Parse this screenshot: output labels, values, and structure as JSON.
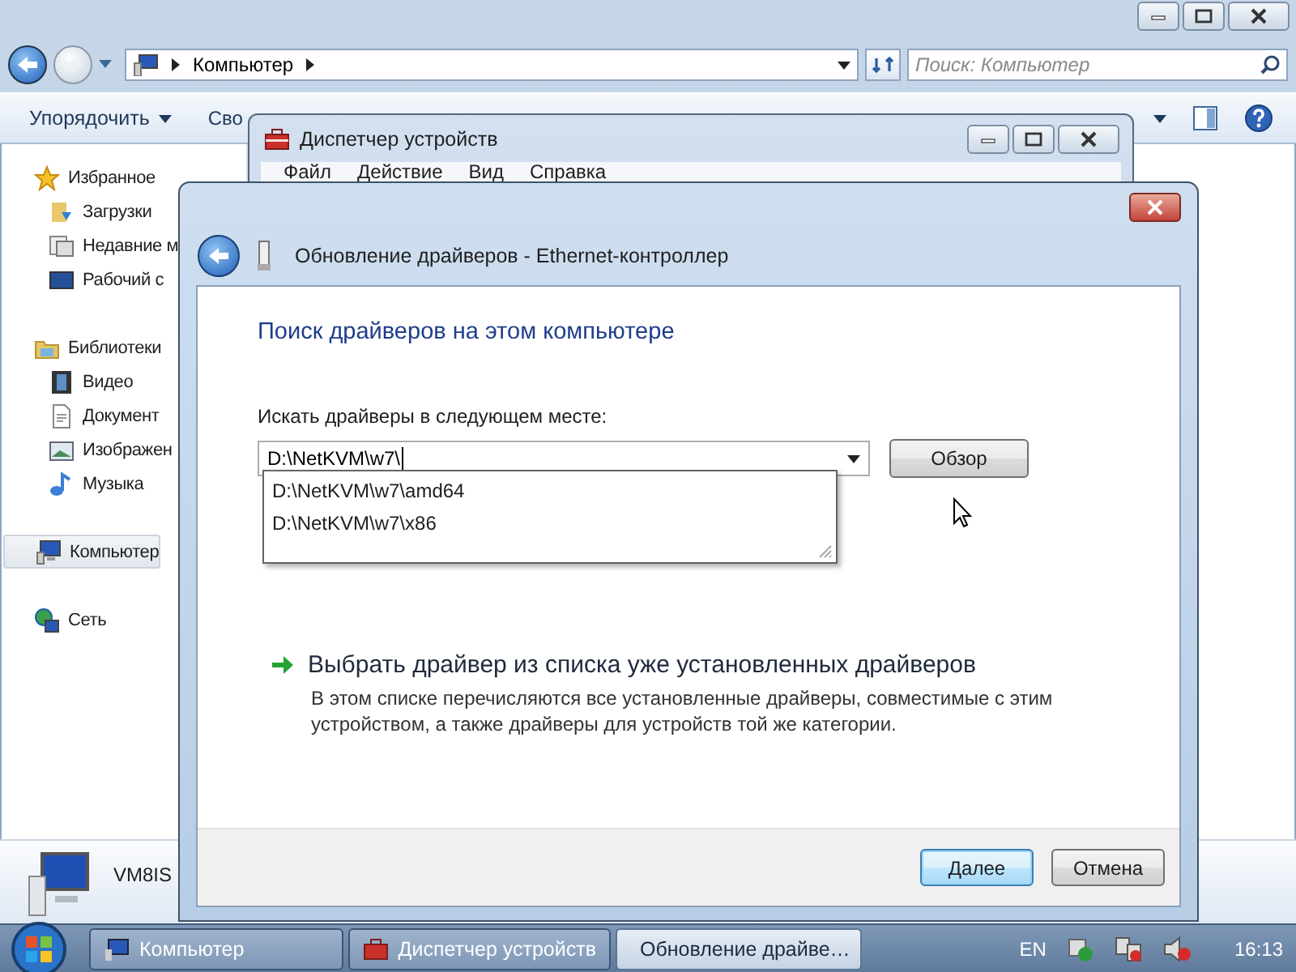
{
  "explorer": {
    "address_path": "Компьютер",
    "search": {
      "placeholder": "Поиск: Компьютер"
    },
    "toolbar": [
      "Упорядочить",
      "Сво"
    ],
    "sidebar": {
      "items": [
        {
          "label": "Избранное",
          "selected": false,
          "children": [
            {
              "label": "Загрузки",
              "selected": false
            },
            {
              "label": "Недавние м",
              "selected": false
            },
            {
              "label": "Рабочий с",
              "selected": false
            }
          ]
        },
        {
          "label": "Библиотеки",
          "selected": false,
          "children": [
            {
              "label": "Видео",
              "selected": false
            },
            {
              "label": "Документ",
              "selected": false
            },
            {
              "label": "Изображен",
              "selected": false
            },
            {
              "label": "Музыка",
              "selected": false
            }
          ]
        },
        {
          "label": "Компьютер",
          "selected": true
        },
        {
          "label": "Сеть",
          "selected": false
        }
      ]
    },
    "details": {
      "name": "VM8IS"
    }
  },
  "device_manager": {
    "title": "Диспетчер устройств",
    "menu": [
      "Файл",
      "Действие",
      "Вид",
      "Справка"
    ]
  },
  "dialog": {
    "title": "Обновление драйверов - Ethernet-контроллер",
    "heading": "Поиск драйверов на этом компьютере",
    "location_label": "Искать драйверы в следующем месте:",
    "location": {
      "value": "D:\\NetKVM\\w7\\",
      "suggestions": [
        "D:\\NetKVM\\w7\\amd64",
        "D:\\NetKVM\\w7\\x86"
      ]
    },
    "browse_button": "Обзор",
    "link": {
      "label": "Выбрать драйвер из списка уже установленных драйверов",
      "description": "В этом списке перечисляются все установленные драйверы, совместимые с этим устройством, а также драйверы для устройств той же категории."
    },
    "buttons": [
      {
        "label": "Далее",
        "default": true
      },
      {
        "label": "Отмена",
        "default": false
      }
    ]
  },
  "taskbar": {
    "tasks": [
      {
        "label": "Компьютер",
        "selected": false
      },
      {
        "label": "Диспетчер устройств",
        "selected": false
      },
      {
        "label": "Обновление драйве…",
        "selected": true
      }
    ],
    "language": "EN",
    "clock": "16:13"
  }
}
